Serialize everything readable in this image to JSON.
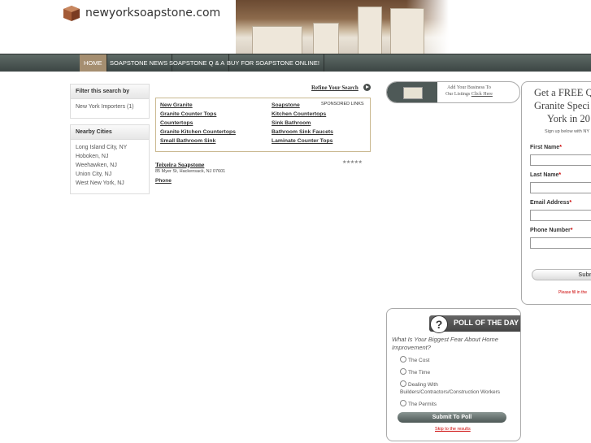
{
  "header": {
    "site_name": "newyorksoapstone.com"
  },
  "nav": {
    "items": [
      "HOME",
      "SOAPSTONE NEWS",
      "SOAPSTONE Q & A",
      "BUY FOR SOAPSTONE ONLINE!"
    ]
  },
  "sidebar": {
    "filter_title": "Filter this search by",
    "filter_items": [
      "New York Importers (1)"
    ],
    "cities_title": "Nearby Cities",
    "cities": [
      "Long Island City, NY",
      "Hoboken, NJ",
      "Weehawken, NJ",
      "Union City, NJ",
      "West New York, NJ"
    ]
  },
  "main": {
    "refine_label": "Refine Your Search",
    "sponsored_label": "SPONSORED LINKS",
    "ads_left": [
      "New Granite",
      "Granite Counter Tops",
      "Countertops",
      "Granite Kitchen Countertops",
      "Small Bathroom Sink"
    ],
    "ads_right": [
      "Soapstone",
      "Kitchen Countertops",
      "Sink Bathroom",
      "Bathroom Sink Faucets",
      "Laminate Counter Tops"
    ],
    "listing": {
      "name": "Teixeira Soapstone",
      "address": "85 Myer St, Hackensack, NJ 07601",
      "phone_label": "Phone",
      "stars": "★★★★★"
    }
  },
  "right": {
    "add_business": {
      "line1": "Add Your Business To",
      "line2": "Our Listings",
      "link": "Click Here"
    },
    "quote": {
      "title_lines": [
        "Get a FREE Q",
        "Granite Speci",
        "York in 20"
      ],
      "subtitle": "Sign up below with NY",
      "fields": [
        "First Name",
        "Last Name",
        "Email Address",
        "Phone Number"
      ],
      "submit_label": "Subm",
      "note": "Please fill in the"
    },
    "poll": {
      "icon": "?",
      "title": "POLL OF THE DAY",
      "question": "What Is Your Biggest Fear About Home Improvement?",
      "options": [
        "The Cost",
        "The Time",
        "Dealing With Builders/Contractors/Construction Workers",
        "The Permits"
      ],
      "submit_label": "Submit To Poll",
      "skip_label": "Skip to the results"
    }
  }
}
